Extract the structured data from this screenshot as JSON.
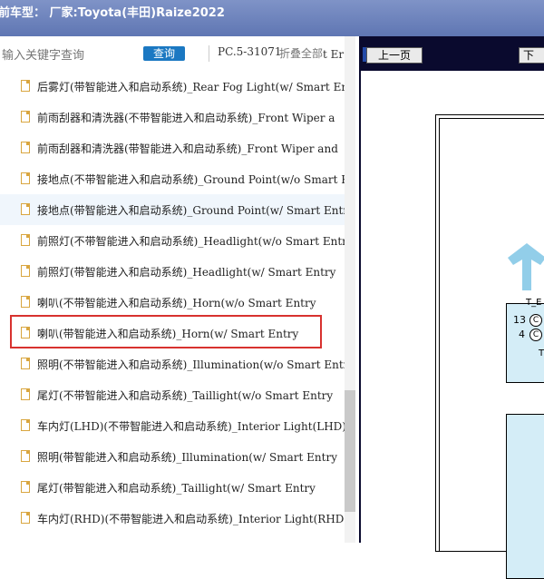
{
  "header": {
    "title": "前车型： 厂家:Toyota(丰田)Raize2022"
  },
  "search": {
    "placeholder": "输入关键字查询",
    "button": "查询",
    "pc_label": "PC.5-31071",
    "collapse": "折叠全部",
    "truncated": "t Er"
  },
  "tree": {
    "items": [
      {
        "label": "后雾灯(带智能进入和启动系统)_Rear Fog Light(w/ Smart Entr"
      },
      {
        "label": "前雨刮器和清洗器(不带智能进入和启动系统)_Front Wiper a"
      },
      {
        "label": "前雨刮器和清洗器(带智能进入和启动系统)_Front Wiper and"
      },
      {
        "label": "接地点(不带智能进入和启动系统)_Ground Point(w/o Smart E"
      },
      {
        "label": "接地点(带智能进入和启动系统)_Ground Point(w/ Smart Entry"
      },
      {
        "label": "前照灯(不带智能进入和启动系统)_Headlight(w/o Smart Entr"
      },
      {
        "label": "前照灯(带智能进入和启动系统)_Headlight(w/ Smart Entry"
      },
      {
        "label": "喇叭(不带智能进入和启动系统)_Horn(w/o Smart Entry"
      },
      {
        "label": "喇叭(带智能进入和启动系统)_Horn(w/ Smart Entry"
      },
      {
        "label": "照明(不带智能进入和启动系统)_Illumination(w/o Smart Entr"
      },
      {
        "label": "尾灯(不带智能进入和启动系统)_Taillight(w/o Smart Entry"
      },
      {
        "label": "车内灯(LHD)(不带智能进入和启动系统)_Interior Light(LHD)"
      },
      {
        "label": "照明(带智能进入和启动系统)_Illumination(w/ Smart Entry"
      },
      {
        "label": "尾灯(带智能进入和启动系统)_Taillight(w/ Smart Entry"
      },
      {
        "label": "车内灯(RHD)(不带智能进入和启动系统)_Interior Light(RHD"
      }
    ]
  },
  "viewer": {
    "prev": "上一页",
    "next": "下",
    "connector": "T_E",
    "pins": [
      {
        "num": "13",
        "code": "C"
      },
      {
        "num": "4",
        "code": "C"
      }
    ],
    "tick": "T"
  },
  "colors": {
    "topbar": "#6b80bd",
    "highlight_box": "#d8322f",
    "search_btn": "#1b78c2",
    "diagram_fill": "#d4edf7"
  }
}
